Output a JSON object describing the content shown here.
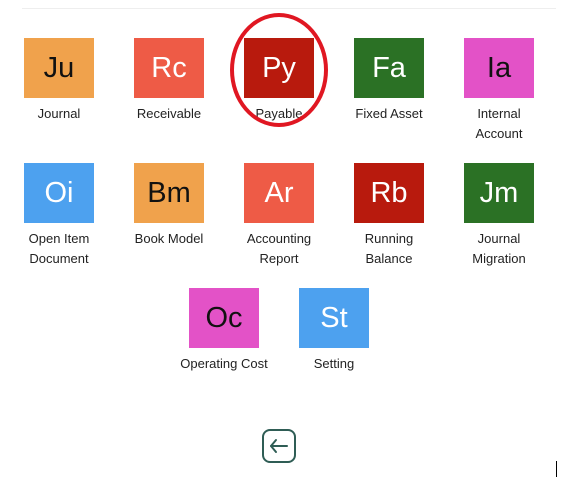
{
  "modules": [
    {
      "abbr": "Ju",
      "label": "Journal",
      "color": "#f0a24c"
    },
    {
      "abbr": "Rc",
      "label": "Receivable",
      "color": "#ee5b46"
    },
    {
      "abbr": "Py",
      "label": "Payable",
      "color": "#b81a0d",
      "highlighted": true
    },
    {
      "abbr": "Fa",
      "label": "Fixed Asset",
      "color": "#2b7125"
    },
    {
      "abbr": "Ia",
      "label": "Internal Account",
      "color": "#e352c7"
    },
    {
      "abbr": "Oi",
      "label": "Open Item Document",
      "color": "#4da1ef"
    },
    {
      "abbr": "Bm",
      "label": "Book Model",
      "color": "#f0a24c"
    },
    {
      "abbr": "Ar",
      "label": "Accounting Report",
      "color": "#ee5b46"
    },
    {
      "abbr": "Rb",
      "label": "Running Balance",
      "color": "#b81a0d"
    },
    {
      "abbr": "Jm",
      "label": "Journal Migration",
      "color": "#2b7125"
    },
    {
      "abbr": "Oc",
      "label": "Operating Cost",
      "color": "#e352c7"
    },
    {
      "abbr": "St",
      "label": "Setting",
      "color": "#4da1ef"
    }
  ],
  "annotation": {
    "highlight_color": "#e01722"
  },
  "footer": {
    "back_icon": "arrow-left-icon"
  }
}
